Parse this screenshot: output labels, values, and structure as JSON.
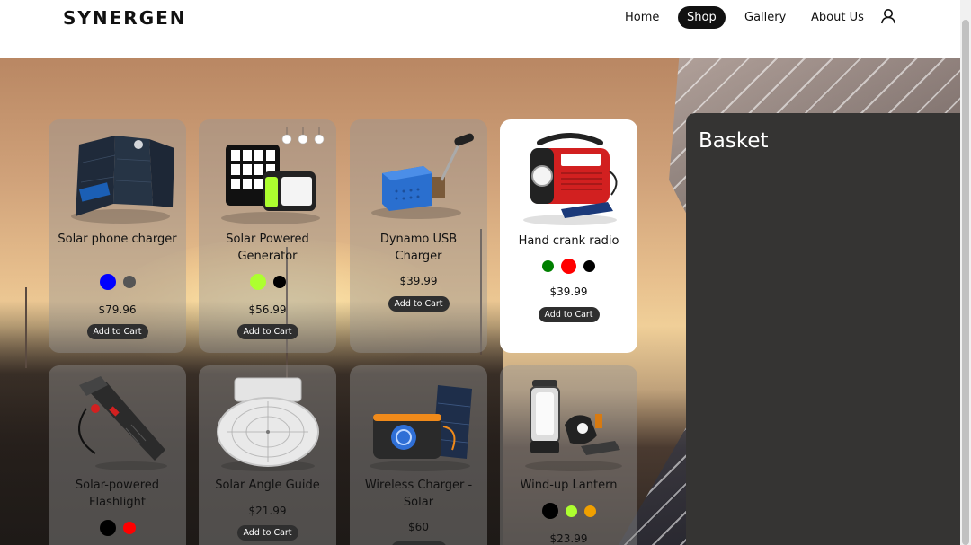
{
  "brand": "SYNERGEN",
  "nav": [
    {
      "label": "Home",
      "active": false
    },
    {
      "label": "Shop",
      "active": true
    },
    {
      "label": "Gallery",
      "active": false
    },
    {
      "label": "About Us",
      "active": false
    }
  ],
  "basket": {
    "title": "Basket"
  },
  "products": [
    {
      "name": "Solar phone charger",
      "price": "$79.96",
      "add_label": "Add to Cart",
      "colors": [
        "#0000ff",
        "#555555"
      ],
      "selected": "#0000ff",
      "image": "solar-panel-charger-image"
    },
    {
      "name": "Solar Powered Generator",
      "price": "$56.99",
      "add_label": "Add to Cart",
      "colors": [
        "#adff2f",
        "#000000"
      ],
      "selected": "#adff2f",
      "image": "solar-generator-image"
    },
    {
      "name": "Dynamo USB Charger",
      "price": "$39.99",
      "add_label": "Add to Cart",
      "colors": [],
      "selected": null,
      "image": "dynamo-charger-image"
    },
    {
      "name": "Hand crank radio",
      "price": "$39.99",
      "add_label": "Add to Cart",
      "colors": [
        "#008000",
        "#ff0000",
        "#000000"
      ],
      "selected": "#ff0000",
      "image": "hand-crank-radio-image"
    },
    {
      "name": "Solar-powered Flashlight",
      "price": "",
      "add_label": "",
      "colors": [
        "#000000",
        "#ff0000"
      ],
      "selected": "#000000",
      "image": "flashlight-image"
    },
    {
      "name": "Solar Angle Guide",
      "price": "$21.99",
      "add_label": "Add to Cart",
      "colors": [],
      "selected": null,
      "image": "angle-guide-image"
    },
    {
      "name": "Wireless Charger - Solar",
      "price": "$60",
      "add_label": "",
      "colors": [],
      "selected": null,
      "image": "wireless-charger-image"
    },
    {
      "name": "Wind-up Lantern",
      "price": "$23.99",
      "add_label": "",
      "colors": [
        "#000000",
        "#adff2f",
        "#f0a000"
      ],
      "selected": "#000000",
      "image": "lantern-image"
    }
  ]
}
